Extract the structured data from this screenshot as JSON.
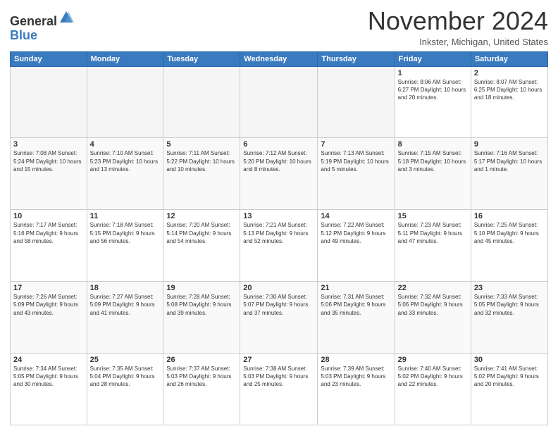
{
  "header": {
    "logo_general": "General",
    "logo_blue": "Blue",
    "month_title": "November 2024",
    "location": "Inkster, Michigan, United States"
  },
  "weekdays": [
    "Sunday",
    "Monday",
    "Tuesday",
    "Wednesday",
    "Thursday",
    "Friday",
    "Saturday"
  ],
  "weeks": [
    [
      {
        "day": "",
        "info": ""
      },
      {
        "day": "",
        "info": ""
      },
      {
        "day": "",
        "info": ""
      },
      {
        "day": "",
        "info": ""
      },
      {
        "day": "",
        "info": ""
      },
      {
        "day": "1",
        "info": "Sunrise: 8:06 AM\nSunset: 6:27 PM\nDaylight: 10 hours\nand 20 minutes."
      },
      {
        "day": "2",
        "info": "Sunrise: 8:07 AM\nSunset: 6:25 PM\nDaylight: 10 hours\nand 18 minutes."
      }
    ],
    [
      {
        "day": "3",
        "info": "Sunrise: 7:08 AM\nSunset: 5:24 PM\nDaylight: 10 hours\nand 15 minutes."
      },
      {
        "day": "4",
        "info": "Sunrise: 7:10 AM\nSunset: 5:23 PM\nDaylight: 10 hours\nand 13 minutes."
      },
      {
        "day": "5",
        "info": "Sunrise: 7:11 AM\nSunset: 5:22 PM\nDaylight: 10 hours\nand 10 minutes."
      },
      {
        "day": "6",
        "info": "Sunrise: 7:12 AM\nSunset: 5:20 PM\nDaylight: 10 hours\nand 8 minutes."
      },
      {
        "day": "7",
        "info": "Sunrise: 7:13 AM\nSunset: 5:19 PM\nDaylight: 10 hours\nand 5 minutes."
      },
      {
        "day": "8",
        "info": "Sunrise: 7:15 AM\nSunset: 5:18 PM\nDaylight: 10 hours\nand 3 minutes."
      },
      {
        "day": "9",
        "info": "Sunrise: 7:16 AM\nSunset: 5:17 PM\nDaylight: 10 hours\nand 1 minute."
      }
    ],
    [
      {
        "day": "10",
        "info": "Sunrise: 7:17 AM\nSunset: 5:16 PM\nDaylight: 9 hours\nand 58 minutes."
      },
      {
        "day": "11",
        "info": "Sunrise: 7:18 AM\nSunset: 5:15 PM\nDaylight: 9 hours\nand 56 minutes."
      },
      {
        "day": "12",
        "info": "Sunrise: 7:20 AM\nSunset: 5:14 PM\nDaylight: 9 hours\nand 54 minutes."
      },
      {
        "day": "13",
        "info": "Sunrise: 7:21 AM\nSunset: 5:13 PM\nDaylight: 9 hours\nand 52 minutes."
      },
      {
        "day": "14",
        "info": "Sunrise: 7:22 AM\nSunset: 5:12 PM\nDaylight: 9 hours\nand 49 minutes."
      },
      {
        "day": "15",
        "info": "Sunrise: 7:23 AM\nSunset: 5:11 PM\nDaylight: 9 hours\nand 47 minutes."
      },
      {
        "day": "16",
        "info": "Sunrise: 7:25 AM\nSunset: 5:10 PM\nDaylight: 9 hours\nand 45 minutes."
      }
    ],
    [
      {
        "day": "17",
        "info": "Sunrise: 7:26 AM\nSunset: 5:09 PM\nDaylight: 9 hours\nand 43 minutes."
      },
      {
        "day": "18",
        "info": "Sunrise: 7:27 AM\nSunset: 5:09 PM\nDaylight: 9 hours\nand 41 minutes."
      },
      {
        "day": "19",
        "info": "Sunrise: 7:28 AM\nSunset: 5:08 PM\nDaylight: 9 hours\nand 39 minutes."
      },
      {
        "day": "20",
        "info": "Sunrise: 7:30 AM\nSunset: 5:07 PM\nDaylight: 9 hours\nand 37 minutes."
      },
      {
        "day": "21",
        "info": "Sunrise: 7:31 AM\nSunset: 5:06 PM\nDaylight: 9 hours\nand 35 minutes."
      },
      {
        "day": "22",
        "info": "Sunrise: 7:32 AM\nSunset: 5:06 PM\nDaylight: 9 hours\nand 33 minutes."
      },
      {
        "day": "23",
        "info": "Sunrise: 7:33 AM\nSunset: 5:05 PM\nDaylight: 9 hours\nand 32 minutes."
      }
    ],
    [
      {
        "day": "24",
        "info": "Sunrise: 7:34 AM\nSunset: 5:05 PM\nDaylight: 9 hours\nand 30 minutes."
      },
      {
        "day": "25",
        "info": "Sunrise: 7:35 AM\nSunset: 5:04 PM\nDaylight: 9 hours\nand 28 minutes."
      },
      {
        "day": "26",
        "info": "Sunrise: 7:37 AM\nSunset: 5:03 PM\nDaylight: 9 hours\nand 26 minutes."
      },
      {
        "day": "27",
        "info": "Sunrise: 7:38 AM\nSunset: 5:03 PM\nDaylight: 9 hours\nand 25 minutes."
      },
      {
        "day": "28",
        "info": "Sunrise: 7:39 AM\nSunset: 5:03 PM\nDaylight: 9 hours\nand 23 minutes."
      },
      {
        "day": "29",
        "info": "Sunrise: 7:40 AM\nSunset: 5:02 PM\nDaylight: 9 hours\nand 22 minutes."
      },
      {
        "day": "30",
        "info": "Sunrise: 7:41 AM\nSunset: 5:02 PM\nDaylight: 9 hours\nand 20 minutes."
      }
    ]
  ]
}
